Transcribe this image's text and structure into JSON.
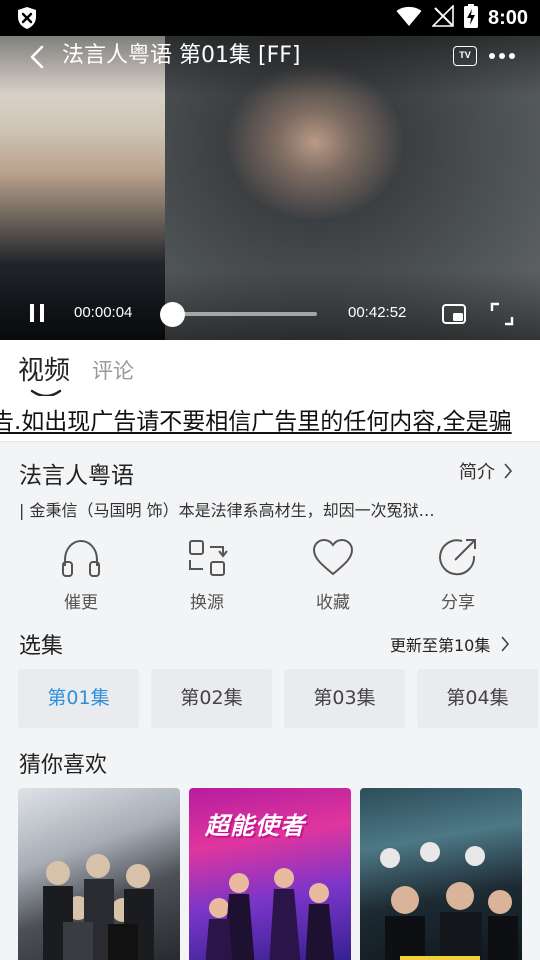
{
  "status_bar": {
    "time": "8:00",
    "icons": [
      "vpn-shield-icon",
      "wifi-icon",
      "no-signal-icon",
      "battery-charging-icon"
    ]
  },
  "player": {
    "title": "法言人粤语 第01集 [FF]",
    "tv_label": "TV",
    "current_time": "00:00:04",
    "total_time": "00:42:52",
    "progress": 0.0016,
    "icons": [
      "back-icon",
      "tv-cast-icon",
      "more-icon",
      "pause-icon",
      "pip-icon",
      "fullscreen-icon"
    ]
  },
  "tabs": {
    "video": "视频",
    "comments": "评论"
  },
  "marquee": {
    "text": "告.如出现广告请不要相信广告里的任何内容,全是骗"
  },
  "show": {
    "title": "法言人粤语",
    "intro_label": "简介",
    "synopsis": "|      金秉信（马国明 饰）本是法律系高材生，却因一次冤狱…"
  },
  "actions": [
    {
      "label": "催更",
      "icon": "headphones-icon"
    },
    {
      "label": "换源",
      "icon": "switch-source-icon"
    },
    {
      "label": "收藏",
      "icon": "heart-icon"
    },
    {
      "label": "分享",
      "icon": "share-icon"
    }
  ],
  "episodes": {
    "heading": "选集",
    "update_label": "更新至第10集",
    "items": [
      "第01集",
      "第02集",
      "第03集",
      "第04集"
    ],
    "selected_index": 0
  },
  "recommendations": {
    "heading": "猜你喜欢",
    "items": [
      {
        "poster_logo": ""
      },
      {
        "poster_logo": "超能使者"
      },
      {
        "poster_logo": ""
      }
    ]
  },
  "colors": {
    "accent": "#2f8fd8",
    "background": "#f3f4f6",
    "status_bar": "#000000"
  }
}
